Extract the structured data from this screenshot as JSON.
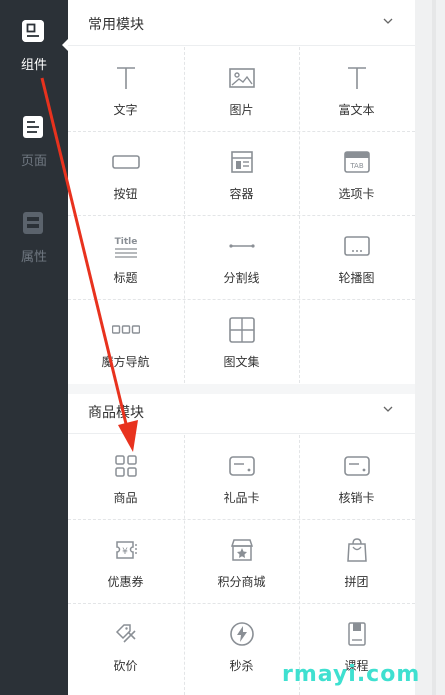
{
  "sidebar": {
    "items": [
      {
        "label": "组件",
        "icon": "component-icon",
        "active": true
      },
      {
        "label": "页面",
        "icon": "page-icon",
        "active": false
      },
      {
        "label": "属性",
        "icon": "property-icon",
        "active": false
      }
    ]
  },
  "sections": [
    {
      "title": "常用模块",
      "items": [
        {
          "label": "文字",
          "icon": "text-icon"
        },
        {
          "label": "图片",
          "icon": "image-icon"
        },
        {
          "label": "富文本",
          "icon": "rich-text-icon"
        },
        {
          "label": "按钮",
          "icon": "button-icon"
        },
        {
          "label": "容器",
          "icon": "container-icon"
        },
        {
          "label": "选项卡",
          "icon": "tab-icon"
        },
        {
          "label": "标题",
          "icon": "title-icon"
        },
        {
          "label": "分割线",
          "icon": "divider-icon"
        },
        {
          "label": "轮播图",
          "icon": "carousel-icon"
        },
        {
          "label": "魔方导航",
          "icon": "cube-nav-icon"
        },
        {
          "label": "图文集",
          "icon": "gallery-icon"
        }
      ]
    },
    {
      "title": "商品模块",
      "items": [
        {
          "label": "商品",
          "icon": "product-icon"
        },
        {
          "label": "礼品卡",
          "icon": "gift-card-icon"
        },
        {
          "label": "核销卡",
          "icon": "redeem-card-icon"
        },
        {
          "label": "优惠券",
          "icon": "coupon-icon"
        },
        {
          "label": "积分商城",
          "icon": "points-mall-icon"
        },
        {
          "label": "拼团",
          "icon": "group-buy-icon"
        },
        {
          "label": "砍价",
          "icon": "bargain-icon"
        },
        {
          "label": "秒杀",
          "icon": "flash-sale-icon"
        },
        {
          "label": "课程",
          "icon": "course-icon"
        }
      ]
    }
  ],
  "icon_texts": {
    "tab": "TAB",
    "title": "Title"
  },
  "watermark": "rmayi.com",
  "colors": {
    "sidebar_bg": "#2b3137",
    "accent": "#ffffff",
    "arrow": "#e8321e",
    "watermark": "#3fe0d0"
  }
}
